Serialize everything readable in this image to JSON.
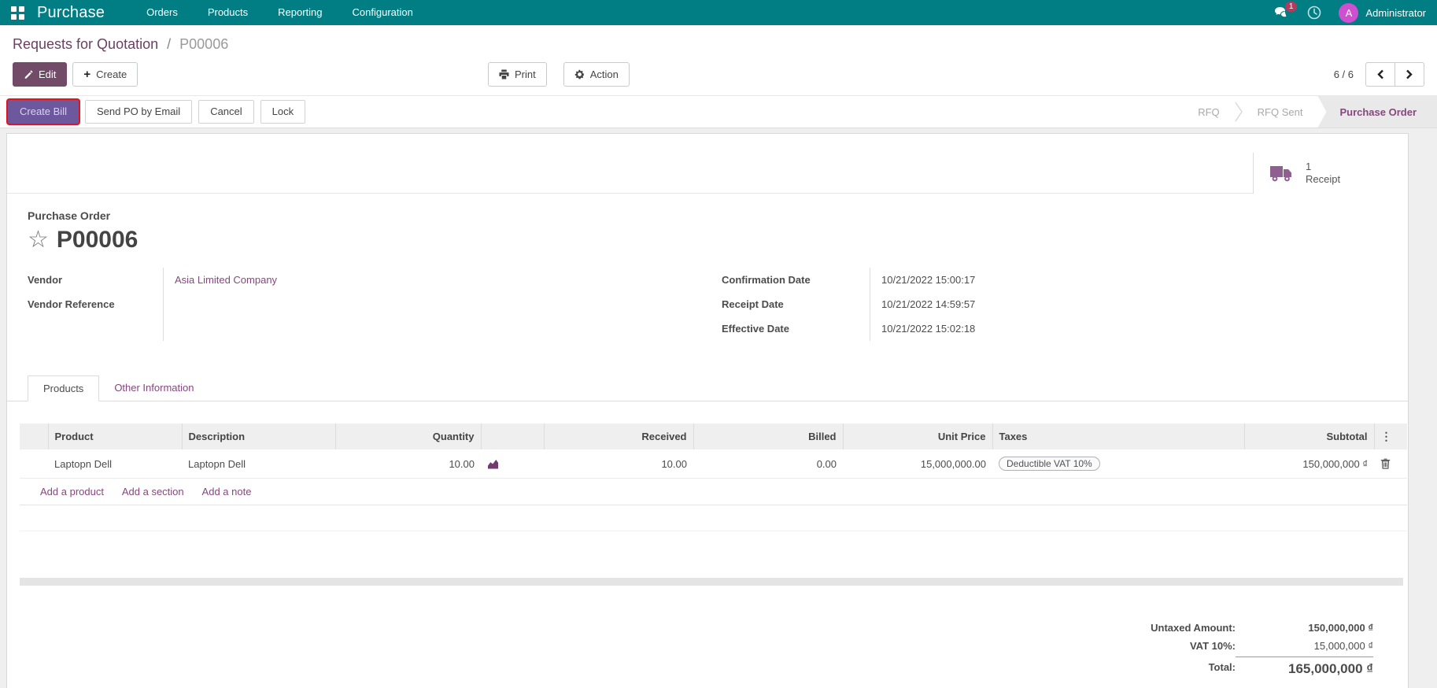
{
  "navbar": {
    "brand": "Purchase",
    "menus": [
      {
        "label": "Orders"
      },
      {
        "label": "Products"
      },
      {
        "label": "Reporting"
      },
      {
        "label": "Configuration"
      }
    ],
    "messages_badge": "1",
    "user_initial": "A",
    "user_name": "Administrator"
  },
  "breadcrumb": {
    "parent": "Requests for Quotation",
    "divider": "/",
    "current": "P00006"
  },
  "actions": {
    "edit": "Edit",
    "create": "Create",
    "print": "Print",
    "action": "Action",
    "pager": "6 / 6"
  },
  "statusbar": {
    "create_bill": "Create Bill",
    "send_po": "Send PO by Email",
    "cancel": "Cancel",
    "lock": "Lock",
    "steps": [
      {
        "label": "RFQ",
        "active": false
      },
      {
        "label": "RFQ Sent",
        "active": false
      },
      {
        "label": "Purchase Order",
        "active": true
      }
    ]
  },
  "smart_buttons": {
    "receipt_count": "1",
    "receipt_label": "Receipt"
  },
  "sheet": {
    "doc_type": "Purchase Order",
    "doc_name": "P00006",
    "vendor_label": "Vendor",
    "vendor_value": "Asia Limited Company",
    "vendor_ref_label": "Vendor Reference",
    "vendor_ref_value": "",
    "confirmation_label": "Confirmation Date",
    "confirmation_value": "10/21/2022 15:00:17",
    "receipt_date_label": "Receipt Date",
    "receipt_date_value": "10/21/2022 14:59:57",
    "effective_label": "Effective Date",
    "effective_value": "10/21/2022 15:02:18"
  },
  "tabs": {
    "products": "Products",
    "other": "Other Information"
  },
  "lines": {
    "headers": {
      "product": "Product",
      "description": "Description",
      "quantity": "Quantity",
      "received": "Received",
      "billed": "Billed",
      "unit_price": "Unit Price",
      "taxes": "Taxes",
      "subtotal": "Subtotal"
    },
    "rows": [
      {
        "product": "Laptopn Dell",
        "description": "Laptopn Dell",
        "quantity": "10.00",
        "received": "10.00",
        "billed": "0.00",
        "unit_price": "15,000,000.00",
        "taxes": "Deductible VAT 10%",
        "subtotal": "150,000,000 ₫"
      }
    ],
    "add_product": "Add a product",
    "add_section": "Add a section",
    "add_note": "Add a note"
  },
  "totals": {
    "untaxed_label": "Untaxed Amount:",
    "untaxed_value": "150,000,000 ₫",
    "tax_label": "VAT 10%:",
    "tax_value": "15,000,000 ₫",
    "total_label": "Total:",
    "total_value": "165,000,000 ₫"
  },
  "colors": {
    "navbar_teal": "#017e84",
    "primary_purple": "#714B67",
    "highlight_red": "#e3131b",
    "violet_button": "#6d579d",
    "link_purple": "#85477d",
    "avatar_magenta": "#ce4fd0",
    "badge_red": "#b23b5e"
  }
}
